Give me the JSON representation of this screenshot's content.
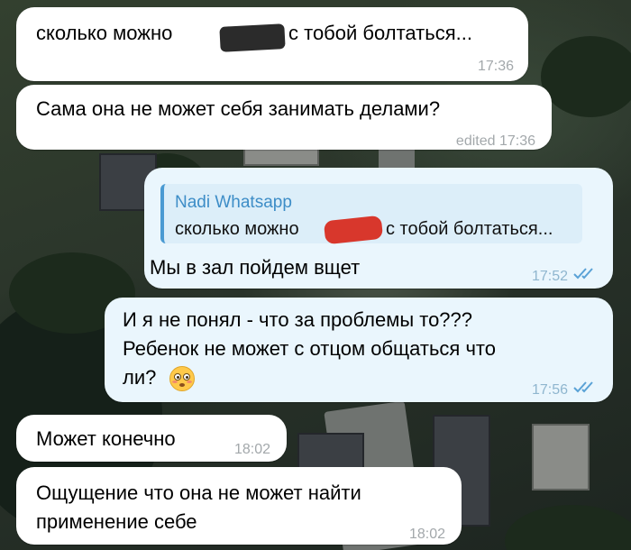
{
  "messages": [
    {
      "id": "m1",
      "direction": "incoming",
      "text_before": "сколько можно",
      "text_after": "с тобой болтаться...",
      "time": "17:36"
    },
    {
      "id": "m2",
      "direction": "incoming",
      "text": "Сама она не может себя занимать делами?",
      "time": "edited 17:36"
    },
    {
      "id": "m3",
      "direction": "outgoing",
      "reply": {
        "name": "Nadi Whatsapp",
        "text_before": "сколько можно",
        "text_after": "с тобой болтаться..."
      },
      "text": "Мы в зал пойдем вщет",
      "time": "17:52",
      "status": "read"
    },
    {
      "id": "m4",
      "direction": "outgoing",
      "lines": [
        "И я не понял - что за проблемы то???",
        "Ребенок не может с отцом общаться что",
        "ли?"
      ],
      "emoji": "flushed-face",
      "time": "17:56",
      "status": "read"
    },
    {
      "id": "m5",
      "direction": "incoming",
      "text": "Может конечно",
      "time": "18:02"
    },
    {
      "id": "m6",
      "direction": "incoming",
      "lines": [
        "Ощущение что она не может найти",
        "применение себе"
      ],
      "time": "18:02"
    }
  ],
  "colors": {
    "incoming_bubble": "#ffffff",
    "outgoing_bubble": "#eaf6fd",
    "reply_name": "#3d8dc7",
    "read_ticks": "#5aa2d6",
    "censor_marker_red": "#d8372c",
    "censor_marker_dark": "#2b2b2b"
  }
}
